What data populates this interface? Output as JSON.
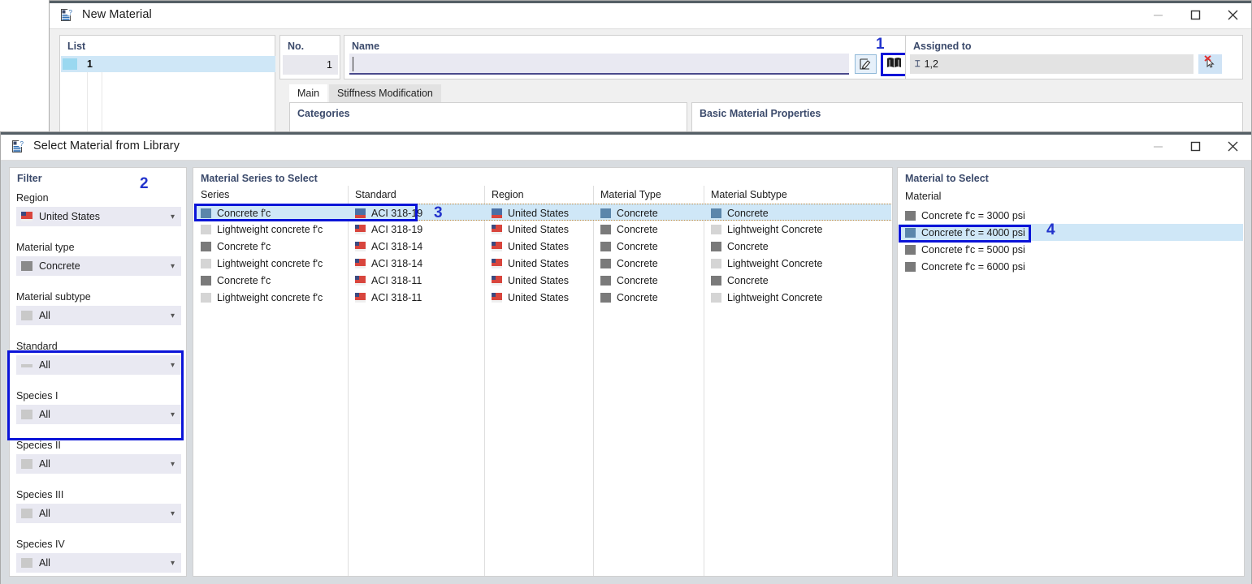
{
  "new_material_window": {
    "title": "New Material",
    "app_icon": "material-table-icon",
    "controls": {
      "minimize": "—",
      "maximize": "☐",
      "close": "✕"
    },
    "list_panel": {
      "header": "List",
      "rows": [
        "1"
      ]
    },
    "no_panel": {
      "header": "No.",
      "value": "1"
    },
    "name_panel": {
      "header": "Name",
      "value": "",
      "placeholder": "",
      "edit_button": "edit-icon",
      "library_button": "book-icon"
    },
    "assigned_panel": {
      "header": "Assigned to",
      "value": "1,2",
      "clear_button": "cursor-delete-icon"
    },
    "tabs": [
      {
        "label": "Main",
        "active": true
      },
      {
        "label": "Stiffness Modification",
        "active": false
      }
    ],
    "sub_panels": [
      {
        "header": "Categories"
      },
      {
        "header": "Basic Material Properties"
      }
    ]
  },
  "library_window": {
    "title": "Select Material from Library",
    "app_icon": "material-table-icon",
    "controls": {
      "minimize": "—",
      "maximize": "☐",
      "close": "✕"
    },
    "filter": {
      "header": "Filter",
      "fields": [
        {
          "label": "Region",
          "value": "United States",
          "swatch": "flag-us"
        },
        {
          "label": "Material type",
          "value": "Concrete",
          "swatch": "gray-dark"
        },
        {
          "label": "Material subtype",
          "value": "All",
          "swatch": "gray-light"
        },
        {
          "label": "Standard",
          "value": "All",
          "swatch": "gray-line"
        },
        {
          "label": "Species I",
          "value": "All",
          "swatch": "gray-light"
        },
        {
          "label": "Species II",
          "value": "All",
          "swatch": "gray-light"
        },
        {
          "label": "Species III",
          "value": "All",
          "swatch": "gray-light"
        },
        {
          "label": "Species IV",
          "value": "All",
          "swatch": "gray-light"
        }
      ]
    },
    "series_panel": {
      "header": "Material Series to Select",
      "columns": [
        "Series",
        "Standard",
        "Region",
        "Material Type",
        "Material Subtype"
      ],
      "rows": [
        {
          "series": "Concrete f'c",
          "standard": "ACI 318-19",
          "region": "United States",
          "material_type": "Concrete",
          "material_subtype": "Concrete",
          "selected": true
        },
        {
          "series": "Lightweight concrete f'c",
          "standard": "ACI 318-19",
          "region": "United States",
          "material_type": "Concrete",
          "material_subtype": "Lightweight Concrete",
          "selected": false
        },
        {
          "series": "Concrete f'c",
          "standard": "ACI 318-14",
          "region": "United States",
          "material_type": "Concrete",
          "material_subtype": "Concrete",
          "selected": false
        },
        {
          "series": "Lightweight concrete f'c",
          "standard": "ACI 318-14",
          "region": "United States",
          "material_type": "Concrete",
          "material_subtype": "Lightweight Concrete",
          "selected": false
        },
        {
          "series": "Concrete f'c",
          "standard": "ACI 318-11",
          "region": "United States",
          "material_type": "Concrete",
          "material_subtype": "Concrete",
          "selected": false
        },
        {
          "series": "Lightweight concrete f'c",
          "standard": "ACI 318-11",
          "region": "United States",
          "material_type": "Concrete",
          "material_subtype": "Lightweight Concrete",
          "selected": false
        }
      ]
    },
    "material_panel": {
      "header": "Material to Select",
      "column": "Material",
      "rows": [
        {
          "label": "Concrete f'c = 3000 psi",
          "selected": false
        },
        {
          "label": "Concrete f'c = 4000 psi",
          "selected": true
        },
        {
          "label": "Concrete f'c = 5000 psi",
          "selected": false
        },
        {
          "label": "Concrete f'c = 6000 psi",
          "selected": false
        }
      ]
    }
  },
  "annotations": [
    {
      "number": "1",
      "target": "library-button"
    },
    {
      "number": "2",
      "target": "filter-region-material-type"
    },
    {
      "number": "3",
      "target": "series-row-concrete-aci-318-19"
    },
    {
      "number": "4",
      "target": "material-row-4000-psi"
    }
  ],
  "colors": {
    "annotation_blue": "#0b14d8",
    "selection_blue": "#cfe7f7",
    "header_text": "#3b4a6b",
    "window_chrome": "#555f66"
  }
}
